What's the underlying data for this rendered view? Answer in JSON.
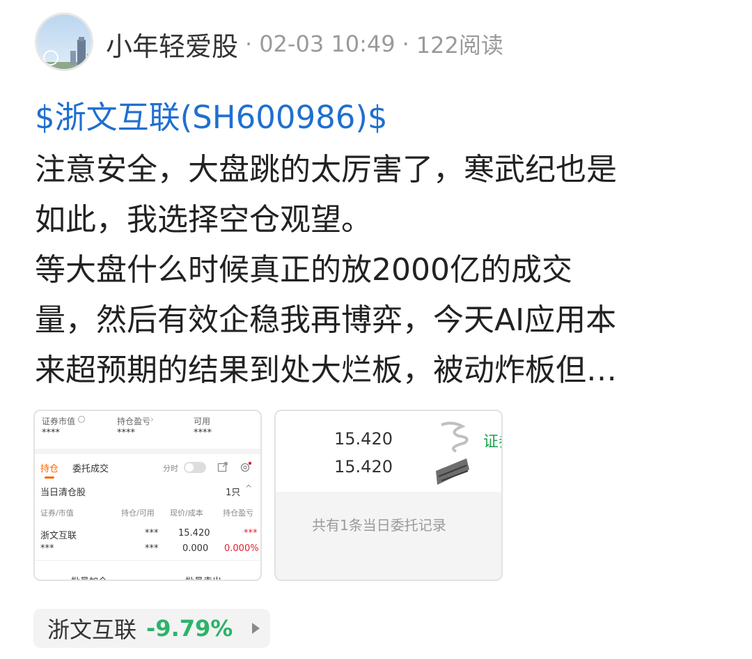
{
  "header": {
    "author": "小年轻爱股",
    "time": "02-03 10:49",
    "reads": "122阅读",
    "separator": "·"
  },
  "post": {
    "stock_link": "$浙文互联(SH600986)$",
    "lines": [
      "注意安全，大盘跳的太厉害了，寒武纪也是",
      "如此，我选择空仓观望。",
      "等大盘什么时候真正的放2000亿的成交",
      "量，然后有效企稳我再博弈，今天AI应用本",
      "来超预期的结果到处大烂板，被动炸板但…"
    ]
  },
  "image1": {
    "summary_labels": [
      "证券市值",
      "持仓盈亏",
      "可用"
    ],
    "summary_values": [
      "****",
      "****",
      "****"
    ],
    "tabs": [
      "持仓",
      "委托成交"
    ],
    "toggle_label": "分时",
    "cleared_label": "当日清仓股",
    "cleared_count": "1只",
    "col_headers": [
      "证券/市值",
      "持仓/可用",
      "现价/成本",
      "持仓盈亏"
    ],
    "row1": [
      "浙文互联",
      "***",
      "15.420",
      "***"
    ],
    "row2": [
      "***",
      "***",
      "0.000",
      "0.000%"
    ],
    "bottom_buttons": [
      "批量加仓",
      "批量卖出"
    ]
  },
  "image2": {
    "price1": "15.420",
    "price2": "15.420",
    "cut_label": "证券",
    "footer_text": "共有1条当日委托记录"
  },
  "chip": {
    "name": "浙文互联",
    "change": "-9.79%"
  },
  "colors": {
    "link": "#1f6fd1",
    "accent_orange": "#ff6600",
    "negative_green": "#2db36a",
    "positive_red": "#e0202f"
  }
}
